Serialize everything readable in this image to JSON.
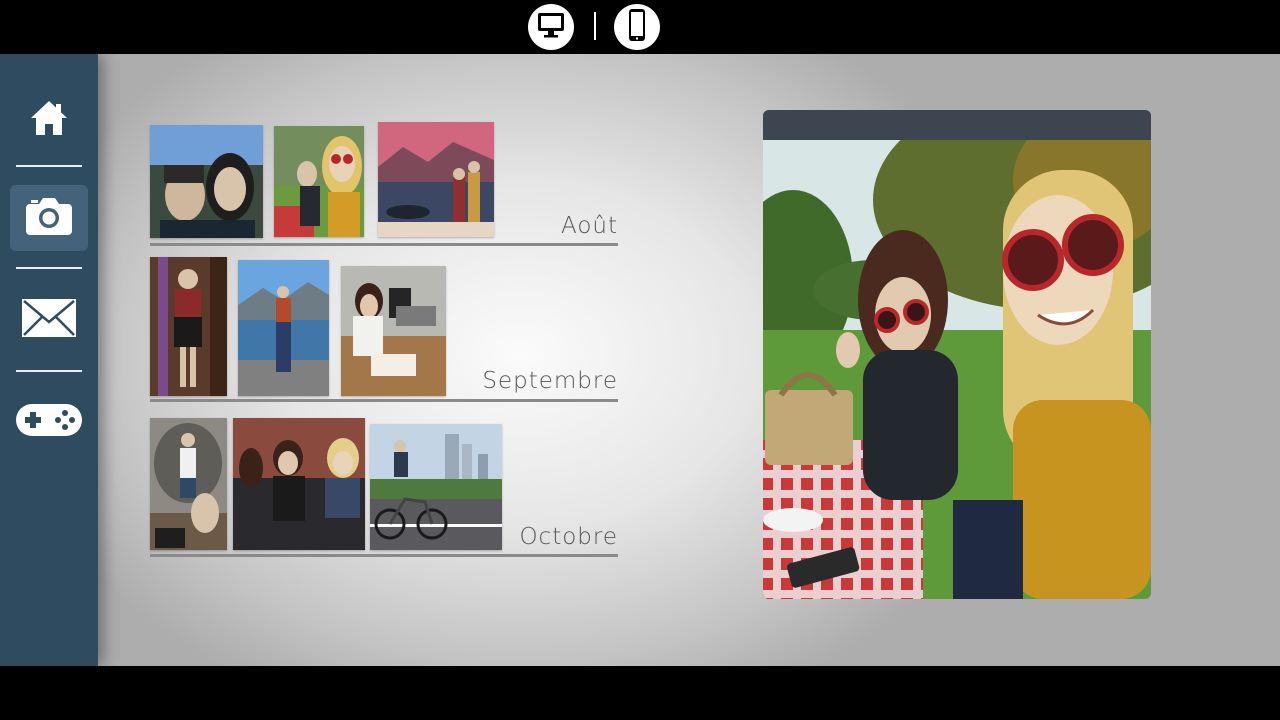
{
  "topbar": {
    "modes": [
      {
        "name": "desktop",
        "icon": "monitor-icon"
      },
      {
        "name": "phone",
        "icon": "smartphone-icon"
      }
    ]
  },
  "sidebar": {
    "items": [
      {
        "id": "home",
        "icon": "home-icon",
        "active": false
      },
      {
        "id": "camera",
        "icon": "camera-icon",
        "active": true
      },
      {
        "id": "mail",
        "icon": "envelope-icon",
        "active": false
      },
      {
        "id": "games",
        "icon": "gamepad-icon",
        "active": false
      }
    ]
  },
  "gallery": {
    "months": [
      {
        "label": "Août",
        "photos": [
          "selfie-couple",
          "picnic-selfie",
          "lake-sunset"
        ]
      },
      {
        "label": "Septembre",
        "photos": [
          "mirror-selfie",
          "lake-pier",
          "classroom"
        ]
      },
      {
        "label": "Octobre",
        "photos": [
          "stone-wall-girls",
          "friends-sofa",
          "city-bike"
        ]
      }
    ]
  },
  "preview": {
    "photo": "picnic-selfie"
  },
  "colors": {
    "sidebar": "#2f4b5f",
    "sidebar_active": "#44637a",
    "preview_header": "#3d4650"
  }
}
